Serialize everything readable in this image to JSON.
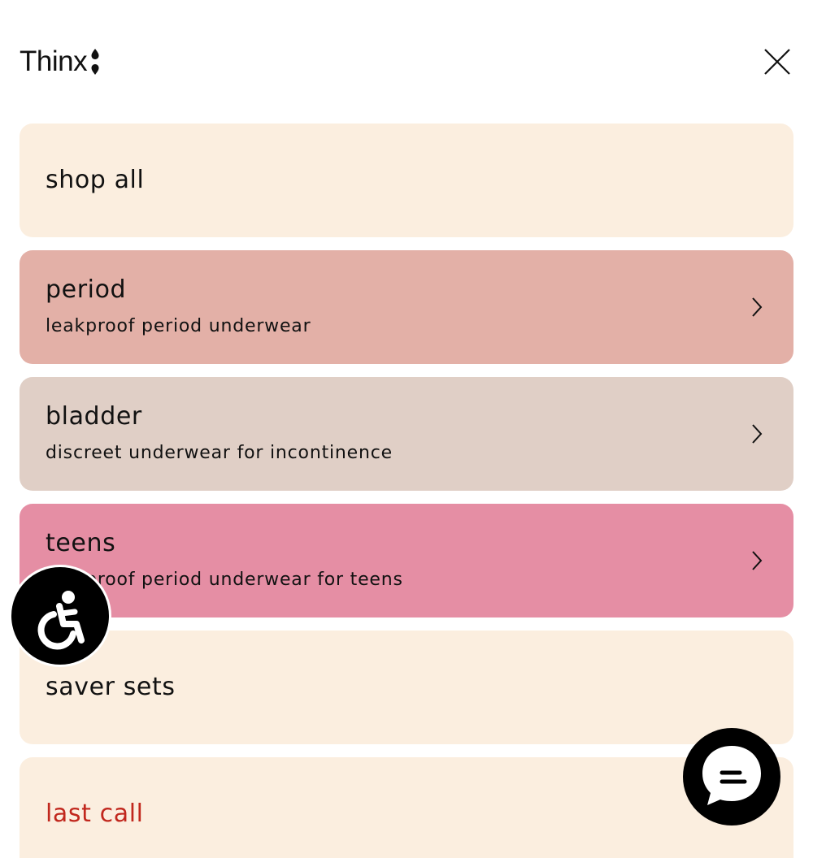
{
  "header": {
    "logo_text": "Thinx",
    "logo_icon": "droplet-mark-icon",
    "close_icon": "close-icon"
  },
  "menu": {
    "items": [
      {
        "title": "shop all",
        "subtitle": "",
        "has_chevron": false,
        "bg": "#fbeedf",
        "title_color": "#111111"
      },
      {
        "title": "period",
        "subtitle": "leakproof period underwear",
        "has_chevron": true,
        "bg": "#e3b0a7",
        "title_color": "#111111"
      },
      {
        "title": "bladder",
        "subtitle": "discreet underwear for incontinence",
        "has_chevron": true,
        "bg": "#e0cfc6",
        "title_color": "#111111"
      },
      {
        "title": "teens",
        "subtitle": "leakproof period underwear for teens",
        "has_chevron": true,
        "bg": "#e58ea4",
        "title_color": "#111111"
      },
      {
        "title": "saver sets",
        "subtitle": "",
        "has_chevron": false,
        "bg": "#fbeedf",
        "title_color": "#111111"
      },
      {
        "title": "last call",
        "subtitle": "",
        "has_chevron": false,
        "bg": "#fbeedf",
        "title_color": "#c1271d"
      }
    ]
  },
  "floating": {
    "accessibility_icon": "wheelchair-accessibility-icon",
    "chat_icon": "chat-bubble-icon"
  }
}
